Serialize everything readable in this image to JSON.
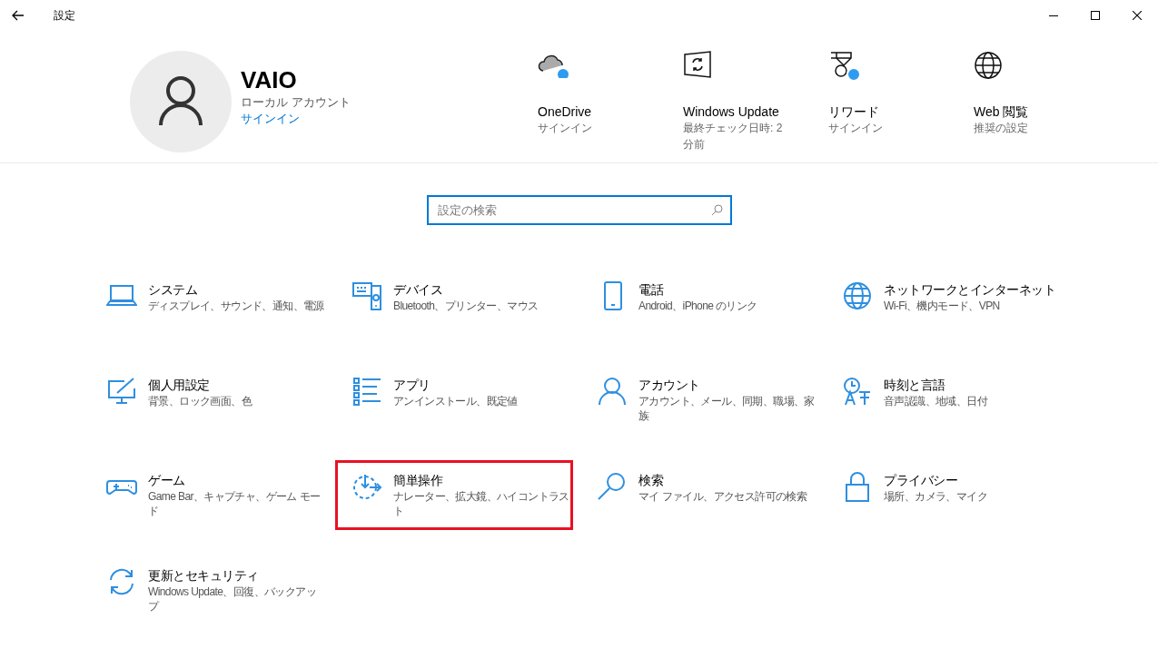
{
  "window": {
    "title": "設定"
  },
  "profile": {
    "name": "VAIO",
    "account_type": "ローカル アカウント",
    "sign_in_link": "サインイン"
  },
  "quick_links": [
    {
      "label": "OneDrive",
      "detail": "サインイン",
      "badge": true
    },
    {
      "label": "Windows Update",
      "detail": "最終チェック日時: 2 分前",
      "badge": false
    },
    {
      "label": "リワード",
      "detail": "サインイン",
      "badge": true
    },
    {
      "label": "Web 閲覧",
      "detail": "推奨の設定",
      "badge": false
    }
  ],
  "search": {
    "placeholder": "設定の検索"
  },
  "categories": [
    {
      "title": "システム",
      "subtitle": "ディスプレイ、サウンド、通知、電源",
      "highlighted": false
    },
    {
      "title": "デバイス",
      "subtitle": "Bluetooth、プリンター、マウス",
      "highlighted": false
    },
    {
      "title": "電話",
      "subtitle": "Android、iPhone のリンク",
      "highlighted": false
    },
    {
      "title": "ネットワークとインターネット",
      "subtitle": "Wi-Fi、機内モード、VPN",
      "highlighted": false
    },
    {
      "title": "個人用設定",
      "subtitle": "背景、ロック画面、色",
      "highlighted": false
    },
    {
      "title": "アプリ",
      "subtitle": "アンインストール、既定値",
      "highlighted": false
    },
    {
      "title": "アカウント",
      "subtitle": "アカウント、メール、同期、職場、家族",
      "highlighted": false
    },
    {
      "title": "時刻と言語",
      "subtitle": "音声認識、地域、日付",
      "highlighted": false
    },
    {
      "title": "ゲーム",
      "subtitle": "Game Bar、キャプチャ、ゲーム モード",
      "highlighted": false
    },
    {
      "title": "簡単操作",
      "subtitle": "ナレーター、拡大鏡、ハイコントラスト",
      "highlighted": true
    },
    {
      "title": "検索",
      "subtitle": "マイ ファイル、アクセス許可の検索",
      "highlighted": false
    },
    {
      "title": "プライバシー",
      "subtitle": "場所、カメラ、マイク",
      "highlighted": false
    },
    {
      "title": "更新とセキュリティ",
      "subtitle": "Windows Update、回復、バックアップ",
      "highlighted": false
    }
  ]
}
